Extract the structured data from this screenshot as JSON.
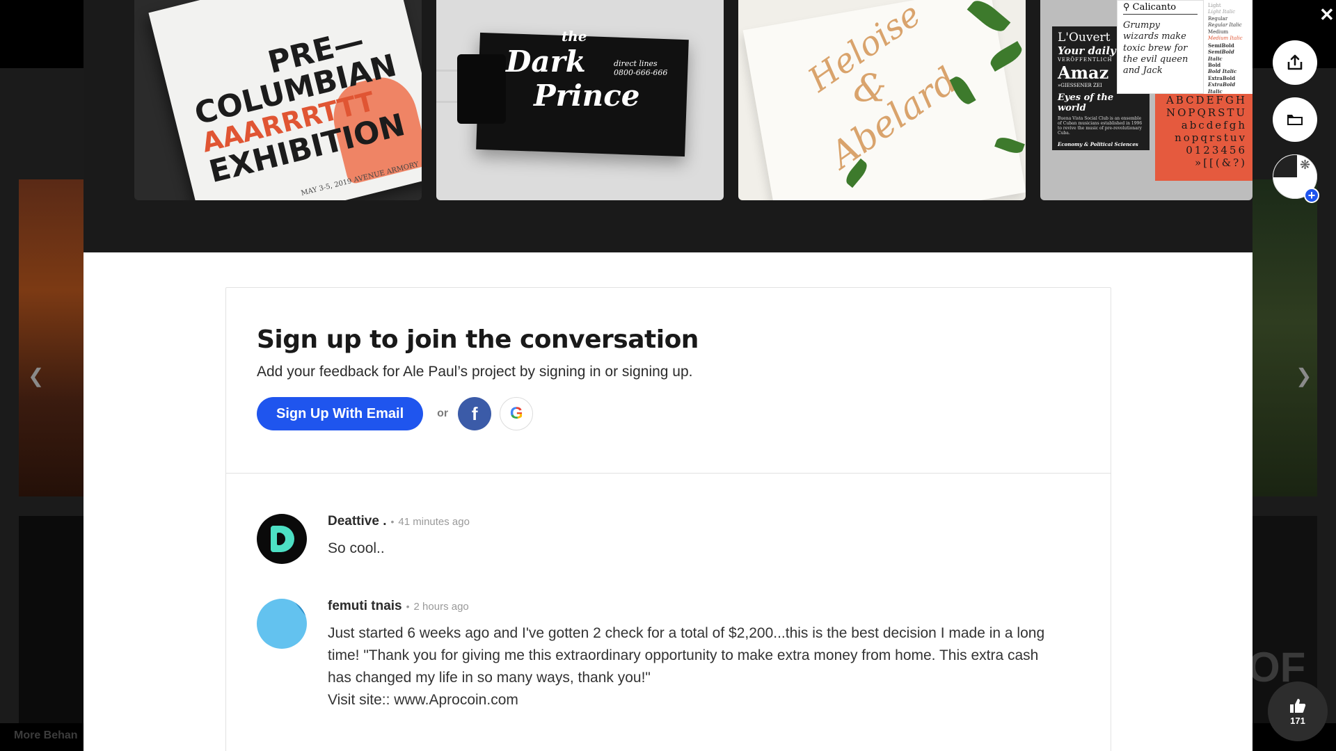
{
  "background": {
    "more_label": "More Behan",
    "right_bg_text": "OF"
  },
  "gallery": {
    "tile1": {
      "lines": [
        "PRE—",
        "COLUMBIAN",
        "AAARRRTTT",
        "EXHIBITION"
      ],
      "date": "MAY 3-5, 2019  AVENUE ARMORY"
    },
    "tile2": {
      "the": "the",
      "dark": "Dark",
      "prince": "Prince",
      "side_line1": "direct lines",
      "side_line2": "0800-666-666"
    },
    "tile3": {
      "heloise": "Heloise",
      "amp": "&",
      "abelard": "Abelard"
    },
    "tile4": {
      "font_name": "Calicanto",
      "pangram": "Grumpy wizards make toxic brew for the evil queen and Jack",
      "weights": [
        "Light",
        "Light Italic",
        "Regular",
        "Regular Italic",
        "Medium",
        "Medium Italic",
        "SemiBold",
        "SemiBold Italic",
        "Bold",
        "Bold Italic",
        "ExtraBold",
        "ExtraBold Italic"
      ],
      "black_card": [
        "L'Ouvert",
        "Your daily",
        "VERÖFFENTLICH",
        "Amaz",
        "»GIESSENER ZEI",
        "Eyes of the world",
        "Buena Vista Social Club is an ensemble of Cuban musicians established in 1996 to revive the music of pre-revolutionary Cuba.",
        "Economy & Political Sciences"
      ],
      "red_card": [
        "ABCDEFGH",
        "NOPQRSTU",
        "abcdefgh",
        "nopqrstuv",
        "0123456",
        "»[[(&?)"
      ]
    }
  },
  "signup": {
    "title": "Sign up to join the conversation",
    "subtitle": "Add your feedback for Ale Paul’s project by signing in or signing up.",
    "email_button": "Sign Up With Email",
    "or": "or",
    "facebook_glyph": "f",
    "google_glyph": "G"
  },
  "comments": [
    {
      "author": "Deattive .",
      "time": "41 minutes ago",
      "text": "So cool.."
    },
    {
      "author": "femuti tnais",
      "time": "2 hours ago",
      "text": "Just started 6 weeks ago and I've gotten 2 check for a total of $2,200...this is the best decision I made in a long time! \"Thank you for giving me this extraordinary opportunity to make extra money from home. This extra cash has changed my life in so many ways, thank you!\"\nVisit site:: www.Aprocoin.com"
    }
  ],
  "actions": {
    "appreciate_count": "171"
  },
  "icons": {
    "close": "close-icon",
    "share": "share-icon",
    "folder": "folder-icon",
    "thumbs_up": "thumbs-up-icon",
    "prev": "chevron-left-icon",
    "next": "chevron-right-icon"
  },
  "colors": {
    "primary_blue": "#1f55ee",
    "facebook_blue": "#3b5ba8",
    "accent_orange": "#e05533"
  }
}
